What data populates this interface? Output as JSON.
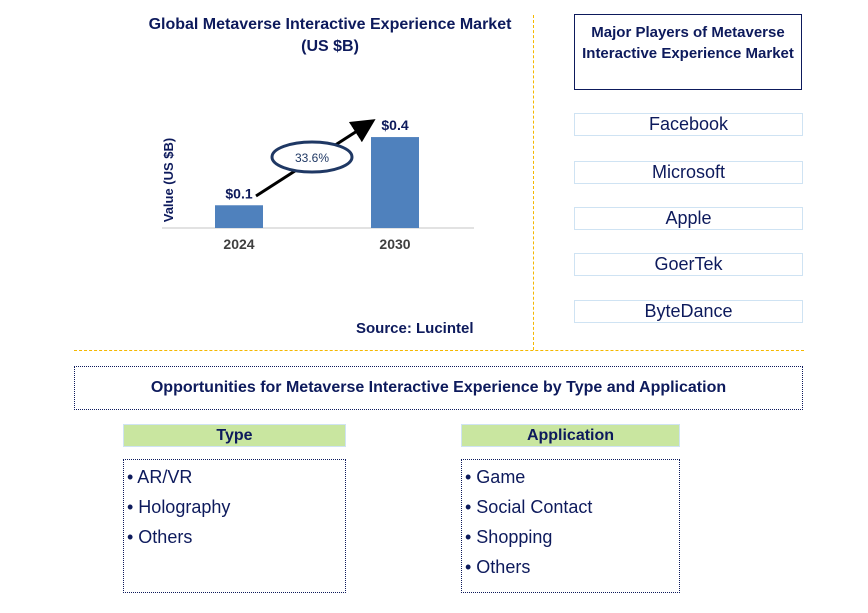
{
  "chart_data": {
    "type": "bar",
    "title": "Global Metaverse Interactive Experience Market (US $B)",
    "title_line1": "Global Metaverse Interactive Experience Market",
    "title_line2": "(US $B)",
    "categories": [
      "2024",
      "2030"
    ],
    "values": [
      0.1,
      0.4
    ],
    "data_labels": [
      "$0.1",
      "$0.4"
    ],
    "xlabel": "",
    "ylabel": "Value (US $B)",
    "ylim": [
      0,
      0.45
    ],
    "grid": false,
    "annotation": {
      "text": "33.6%",
      "meaning": "CAGR",
      "shape": "ellipse-on-arrow"
    },
    "bar_color": "#4f81bd",
    "source": "Source: Lucintel"
  },
  "players": {
    "title": "Major Players of Metaverse Interactive Experience Market",
    "items": [
      "Facebook",
      "Microsoft",
      "Apple",
      "GoerTek",
      "ByteDance"
    ]
  },
  "opportunities": {
    "title": "Opportunities for Metaverse Interactive Experience by Type and Application",
    "type": {
      "header": "Type",
      "items": [
        "• AR/VR",
        "• Holography",
        "• Others"
      ]
    },
    "application": {
      "header": "Application",
      "items": [
        "• Game",
        "• Social Contact",
        "• Shopping",
        "• Others"
      ]
    }
  },
  "colors": {
    "text": "#0d1a5c",
    "bar": "#4f81bd",
    "separator": "#f5b800",
    "segment_header": "#c9e6a0"
  }
}
